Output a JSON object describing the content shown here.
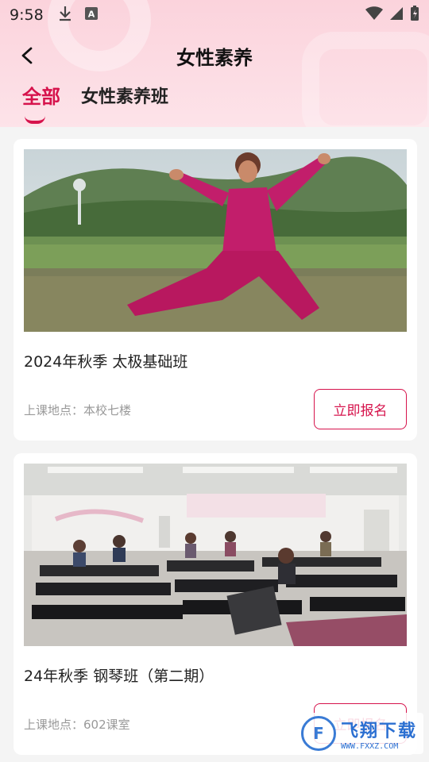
{
  "status_bar": {
    "time": "9:58"
  },
  "header": {
    "title": "女性素养"
  },
  "tabs": [
    {
      "label": "全部",
      "active": true
    },
    {
      "label": "女性素养班",
      "active": false
    }
  ],
  "courses": [
    {
      "title": "2024年秋季 太极基础班",
      "location_label": "上课地点：",
      "location": "本校七楼",
      "button_label": "立即报名"
    },
    {
      "title": "24年秋季 钢琴班（第二期）",
      "location_label": "上课地点：",
      "location": "602课室",
      "button_label": "立即报名"
    }
  ],
  "watermark": {
    "main": "飞翔下载",
    "sub": "WWW.FXXZ.COM",
    "logo": "F"
  },
  "colors": {
    "accent": "#d6134c",
    "header_bg": "#fbd3dc"
  }
}
